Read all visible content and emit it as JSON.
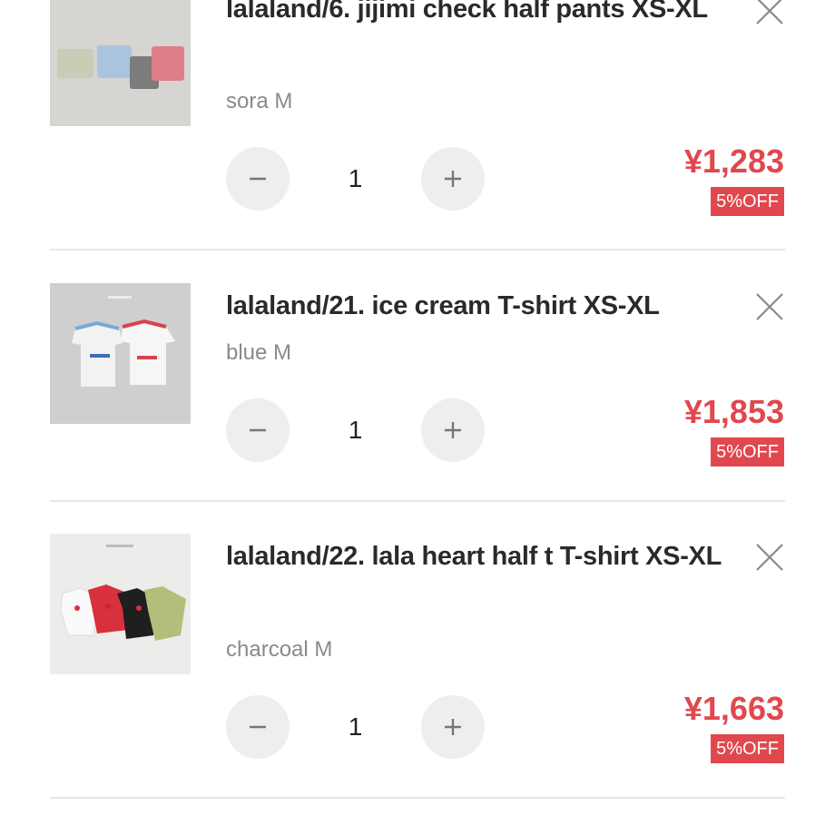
{
  "cart": {
    "items": [
      {
        "title": "lalaland/6. jijimi check half pants XS-XL",
        "variant": "sora M",
        "quantity": "1",
        "price": "¥1,283",
        "discount_badge": "5%OFF"
      },
      {
        "title": "lalaland/21. ice cream T-shirt XS-XL",
        "variant": "blue M",
        "quantity": "1",
        "price": "¥1,853",
        "discount_badge": "5%OFF"
      },
      {
        "title": "lalaland/22. lala heart half t T-shirt XS-XL",
        "variant": "charcoal M",
        "quantity": "1",
        "price": "¥1,663",
        "discount_badge": "5%OFF"
      }
    ]
  },
  "colors": {
    "price": "#e0484e",
    "badge_bg": "#e0484e",
    "stepper_bg": "#eeeeee",
    "divider": "#e6e6e6"
  },
  "icons": {
    "remove": "close-icon",
    "decrease": "minus-icon",
    "increase": "plus-icon"
  }
}
